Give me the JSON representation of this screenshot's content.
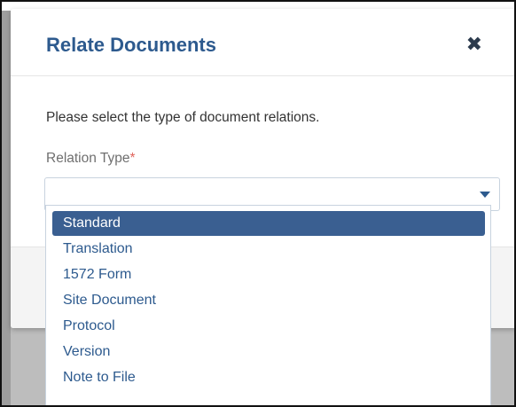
{
  "dialog": {
    "title": "Relate Documents",
    "close_glyph": "✖",
    "instruction": "Please select the type of document relations.",
    "field_label": "Relation Type",
    "required_marker": "*",
    "select_value": ""
  },
  "dropdown": {
    "selected_index": 0,
    "options": [
      {
        "label": "Standard"
      },
      {
        "label": "Translation"
      },
      {
        "label": "1572 Form"
      },
      {
        "label": "Site Document"
      },
      {
        "label": "Protocol"
      },
      {
        "label": "Version"
      },
      {
        "label": "Note to File"
      }
    ]
  },
  "colors": {
    "title": "#2d5a8e",
    "selected_option_bg": "#3a5f91",
    "required": "#e0645c"
  }
}
